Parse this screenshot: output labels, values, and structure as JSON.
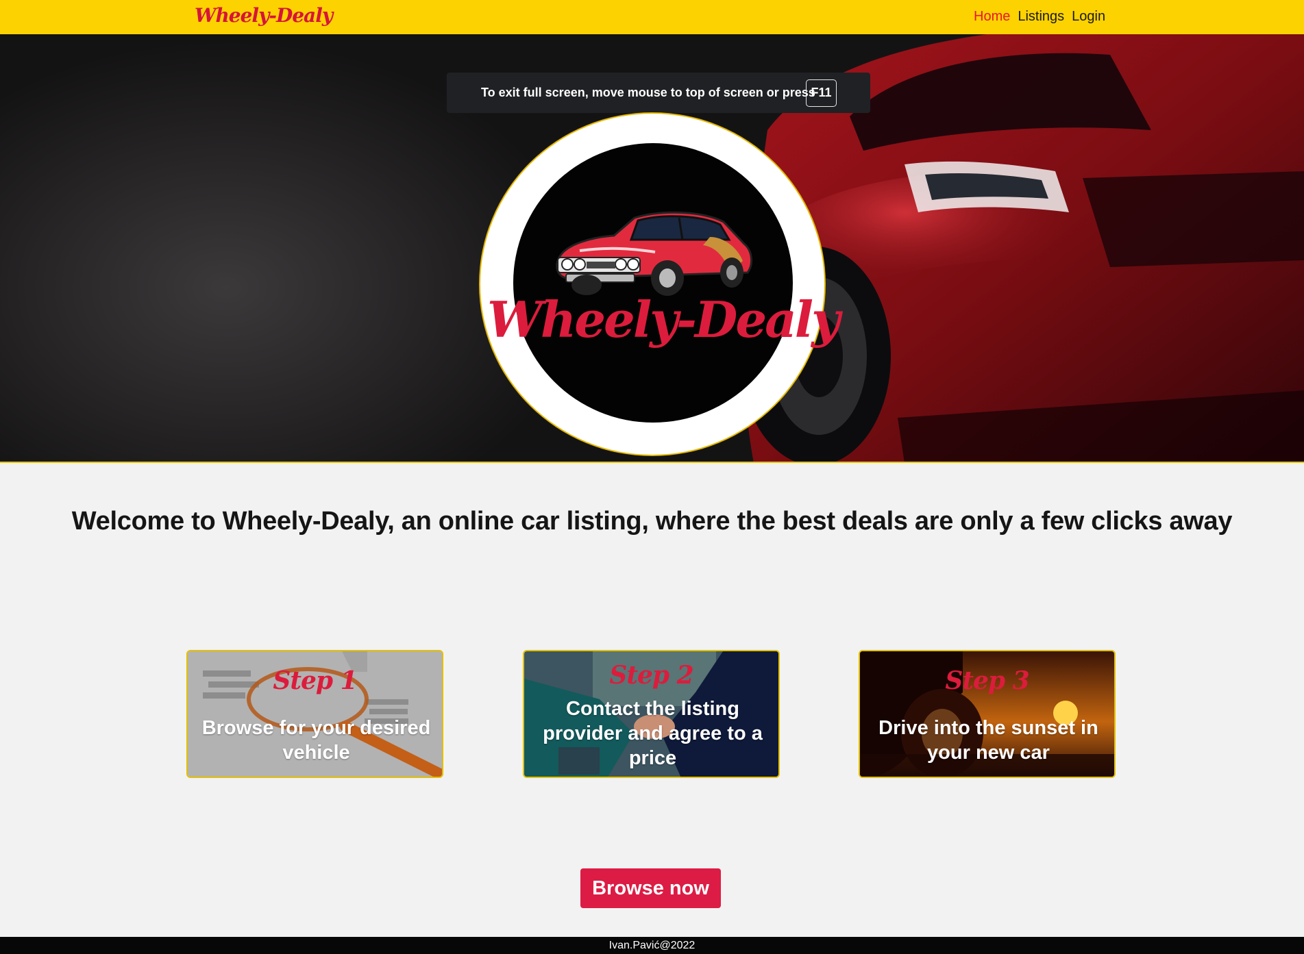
{
  "navbar": {
    "brand": "Wheely-Dealy",
    "links": [
      {
        "label": "Home",
        "active": true
      },
      {
        "label": "Listings",
        "active": false
      },
      {
        "label": "Login",
        "active": false
      }
    ],
    "background_color": "#fcd200",
    "active_color": "#e8162e"
  },
  "fullscreen_toast": {
    "message": "To exit full screen, move mouse to top of screen or press",
    "key": "F11"
  },
  "hero": {
    "logo_text": "Wheely-Dealy",
    "accent_color": "#dc1c3c"
  },
  "welcome": {
    "heading": "Welcome to Wheely-Dealy, an online car listing, where the best deals are only a few clicks away"
  },
  "steps": [
    {
      "label": "Step 1",
      "description": "Browse for your desired vehicle",
      "icon": "magnifying-glass-icon"
    },
    {
      "label": "Step 2",
      "description": "Contact the listing provider and agree to a price",
      "icon": "handshake-icon"
    },
    {
      "label": "Step 3",
      "description": "Drive into the sunset in your new car",
      "icon": "sunset-icon"
    }
  ],
  "cta": {
    "label": "Browse now",
    "color": "#dc1c44"
  },
  "footer": {
    "text": "Ivan.Pavić@2022"
  }
}
